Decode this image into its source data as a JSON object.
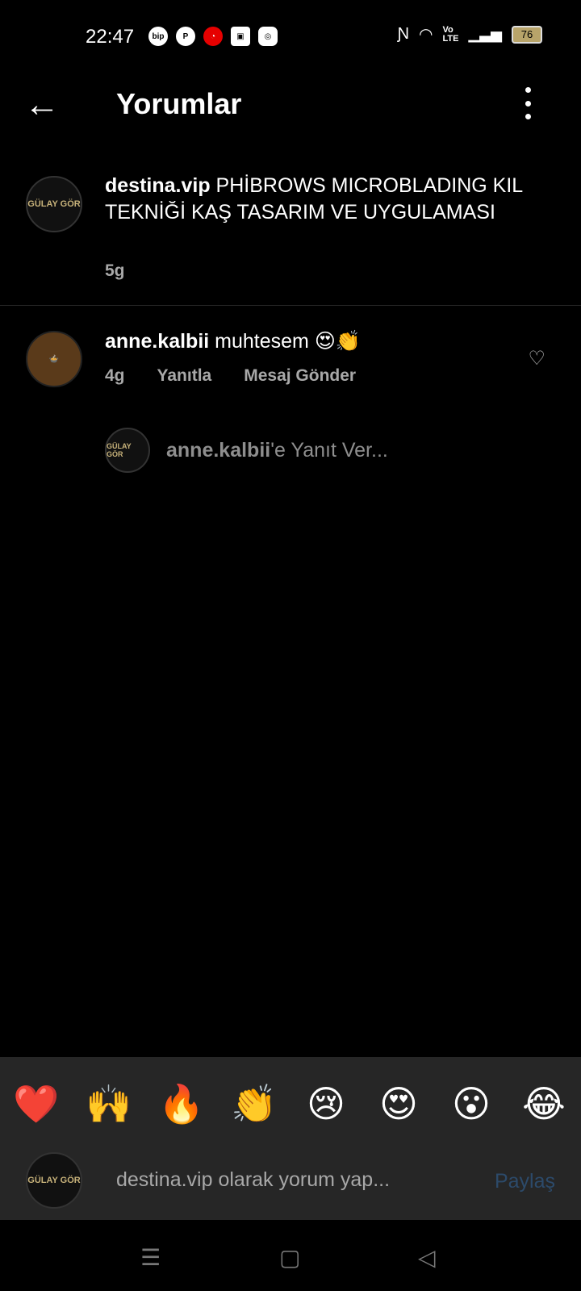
{
  "status_bar": {
    "time": "22:47",
    "left_icons": [
      "bip-icon",
      "pinterest-icon",
      "vodafone-icon",
      "box-icon",
      "instagram-icon"
    ],
    "right_icons": [
      "nfc-icon",
      "wifi-icon",
      "volte-icon",
      "signal-icon"
    ],
    "battery": "76"
  },
  "header": {
    "title": "Yorumlar"
  },
  "caption": {
    "username": "destina.vip",
    "text": "PHİBROWS MICROBLADING KIL TEKNİĞİ KAŞ TASARIM VE UYGULAMASI",
    "time": "5g",
    "avatar_text": "GÜLAY GÖR"
  },
  "comment": {
    "username": "anne.kalbii",
    "text": "muhtesem 😍👏",
    "time": "4g",
    "reply_label": "Yanıtla",
    "message_label": "Mesaj Gönder"
  },
  "reply_prompt": {
    "username": "anne.kalbii",
    "suffix": "'e Yanıt Ver..."
  },
  "emoji_bar": [
    "❤️",
    "🙌",
    "🔥",
    "👏",
    "😢",
    "😍",
    "😮",
    "😂"
  ],
  "input": {
    "placeholder": "destina.vip olarak yorum yap...",
    "share_label": "Paylaş"
  },
  "colors": {
    "background": "#000000",
    "panel": "#262626",
    "muted_text": "#a8a8a8",
    "share_disabled": "#2c4a6a"
  }
}
